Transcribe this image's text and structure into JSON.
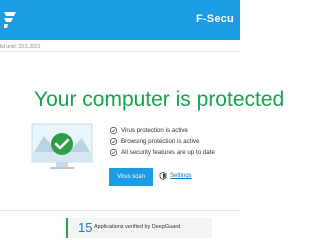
{
  "header": {
    "brand": "F-Secu",
    "accent_color": "#1d9ce6",
    "logo_icon": "f-secure-logo-icon"
  },
  "subscription": {
    "validity_text": "lid until: 23.5.2021"
  },
  "status": {
    "headline": "Your computer is protected",
    "headline_color": "#16a34a",
    "hero_icon": "protected-computer-icon",
    "features": [
      "Virus protection is active",
      "Browsing protection is active",
      "All security features are up to date"
    ]
  },
  "actions": {
    "scan_label": "Virus scan",
    "settings_label": "Settings",
    "settings_icon": "settings-shield-icon"
  },
  "footer": {
    "app_count": "15",
    "app_label": "Applications verified by DeepGuard"
  }
}
